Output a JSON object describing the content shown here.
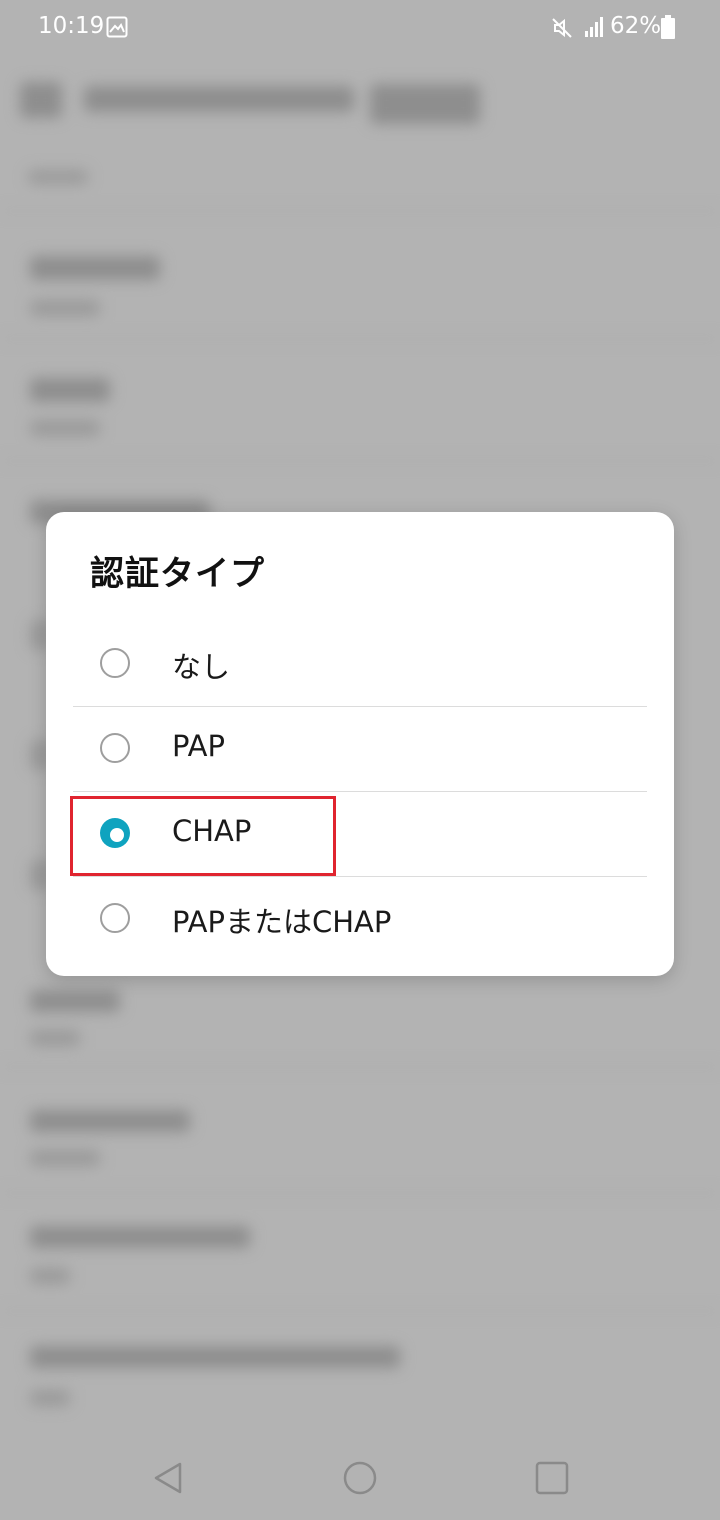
{
  "status_bar": {
    "time": "10:19",
    "battery_percent": "62%",
    "icons": [
      "gallery-icon",
      "mute-icon",
      "signal-icon",
      "battery-icon"
    ]
  },
  "dialog": {
    "title": "認証タイプ",
    "options": [
      {
        "label": "なし",
        "selected": false
      },
      {
        "label": "PAP",
        "selected": false
      },
      {
        "label": "CHAP",
        "selected": true
      },
      {
        "label": "PAPまたはCHAP",
        "selected": false
      }
    ]
  },
  "colors": {
    "accent": "#0fa3bf",
    "highlight": "#e0242f",
    "scrim": "#b3b3b3"
  },
  "nav_bar": {
    "icons": [
      "back-icon",
      "home-icon",
      "recents-icon"
    ]
  }
}
